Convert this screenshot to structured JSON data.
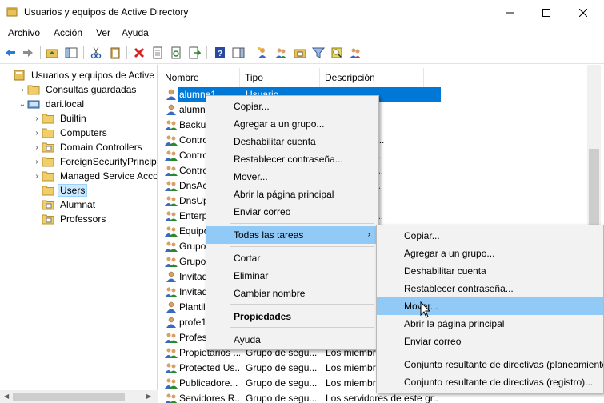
{
  "window": {
    "title": "Usuarios y equipos de Active Directory"
  },
  "menubar": [
    "Archivo",
    "Acción",
    "Ver",
    "Ayuda"
  ],
  "tree": {
    "items": [
      {
        "label": "Usuarios y equipos de Active Dir",
        "indent": 0,
        "icon": "snapin-icon",
        "expander": ""
      },
      {
        "label": "Consultas guardadas",
        "indent": 1,
        "icon": "folder-icon",
        "expander": "›"
      },
      {
        "label": "dari.local",
        "indent": 1,
        "icon": "domain-icon",
        "expander": "⌄"
      },
      {
        "label": "Builtin",
        "indent": 2,
        "icon": "folder-icon",
        "expander": "›"
      },
      {
        "label": "Computers",
        "indent": 2,
        "icon": "folder-icon",
        "expander": "›"
      },
      {
        "label": "Domain Controllers",
        "indent": 2,
        "icon": "ou-folder-icon",
        "expander": "›"
      },
      {
        "label": "ForeignSecurityPrincipals",
        "indent": 2,
        "icon": "folder-icon",
        "expander": "›"
      },
      {
        "label": "Managed Service Accour",
        "indent": 2,
        "icon": "folder-icon",
        "expander": "›"
      },
      {
        "label": "Users",
        "indent": 2,
        "icon": "folder-icon",
        "expander": "",
        "selected": true
      },
      {
        "label": "Alumnat",
        "indent": 2,
        "icon": "ou-folder-icon",
        "expander": ""
      },
      {
        "label": "Professors",
        "indent": 2,
        "icon": "ou-folder-icon",
        "expander": ""
      }
    ]
  },
  "list": {
    "columns": [
      "Nombre",
      "Tipo",
      "Descripción"
    ],
    "rows": [
      {
        "name": "alumne1",
        "type": "Usuario",
        "desc": "",
        "icon": "user-icon",
        "selected": true
      },
      {
        "name": "alumne2",
        "type": "",
        "desc": "",
        "icon": "user-icon"
      },
      {
        "name": "Backu",
        "type": "",
        "desc": "up",
        "icon": "group-icon"
      },
      {
        "name": "Contro",
        "type": "",
        "desc": "ntroladores ...",
        "icon": "group-icon"
      },
      {
        "name": "Contro",
        "type": "",
        "desc": "onar los mi...",
        "icon": "group-icon"
      },
      {
        "name": "Contro",
        "type": "",
        "desc": "s de este gr...",
        "icon": "group-icon"
      },
      {
        "name": "DnsAc",
        "type": "",
        "desc": "ministrador...",
        "icon": "group-icon"
      },
      {
        "name": "DnsUp",
        "type": "",
        "desc": "que tienen...",
        "icon": "group-icon"
      },
      {
        "name": "Enterp",
        "type": "",
        "desc": "s de este gr...",
        "icon": "group-icon"
      },
      {
        "name": "Equipo",
        "type": "",
        "desc": "",
        "icon": "group-icon"
      },
      {
        "name": "Grupo",
        "type": "",
        "desc": "",
        "icon": "group-icon"
      },
      {
        "name": "Grupo",
        "type": "",
        "desc": "",
        "icon": "group-icon"
      },
      {
        "name": "Invitad",
        "type": "",
        "desc": "",
        "icon": "user-icon"
      },
      {
        "name": "Invitad",
        "type": "",
        "desc": "",
        "icon": "group-icon"
      },
      {
        "name": "Plantil",
        "type": "",
        "desc": "",
        "icon": "user-icon"
      },
      {
        "name": "profe1",
        "type": "",
        "desc": "",
        "icon": "user-icon"
      },
      {
        "name": "Profes",
        "type": "",
        "desc": "",
        "icon": "group-icon"
      },
      {
        "name": "Propietarios ...",
        "type": "Grupo de segu...",
        "desc": "Los miembr",
        "icon": "group-icon"
      },
      {
        "name": "Protected Us...",
        "type": "Grupo de segu...",
        "desc": "Los miembr",
        "icon": "group-icon"
      },
      {
        "name": "Publicadore...",
        "type": "Grupo de segu...",
        "desc": "Los miembr",
        "icon": "group-icon"
      },
      {
        "name": "Servidores R...",
        "type": "Grupo de segu...",
        "desc": "Los servidores de este gr...",
        "icon": "group-icon"
      }
    ]
  },
  "context_menu": {
    "items": [
      {
        "label": "Copiar..."
      },
      {
        "label": "Agregar a un grupo..."
      },
      {
        "label": "Deshabilitar cuenta"
      },
      {
        "label": "Restablecer contraseña..."
      },
      {
        "label": "Mover..."
      },
      {
        "label": "Abrir la página principal"
      },
      {
        "label": "Enviar correo"
      },
      {
        "label": "Todas las tareas",
        "submenu": true,
        "highlighted": true
      },
      {
        "label": "Cortar"
      },
      {
        "label": "Eliminar"
      },
      {
        "label": "Cambiar nombre"
      },
      {
        "label": "Propiedades",
        "bold": true
      },
      {
        "label": "Ayuda"
      }
    ]
  },
  "submenu": {
    "items": [
      {
        "label": "Copiar..."
      },
      {
        "label": "Agregar a un grupo..."
      },
      {
        "label": "Deshabilitar cuenta"
      },
      {
        "label": "Restablecer contraseña..."
      },
      {
        "label": "Mover...",
        "highlighted": true
      },
      {
        "label": "Abrir la página principal"
      },
      {
        "label": "Enviar correo"
      },
      {
        "label": "Conjunto resultante de directivas (planeamiento)..."
      },
      {
        "label": "Conjunto resultante de directivas (registro)..."
      }
    ]
  }
}
